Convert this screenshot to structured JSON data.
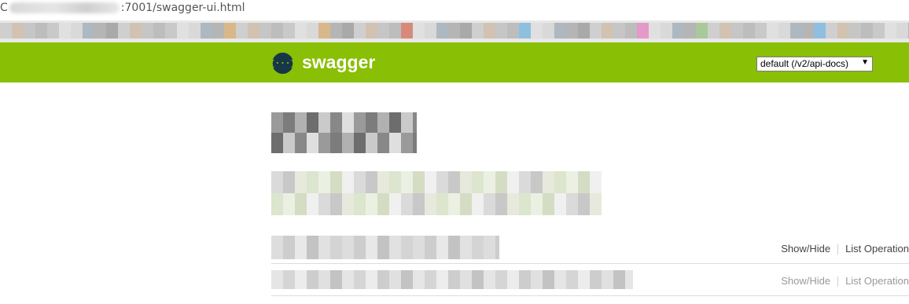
{
  "browser": {
    "url_visible_suffix": ":7001/swagger-ui.html",
    "url_prefix_char": "C"
  },
  "header": {
    "logo_glyph": "{···}",
    "title": "swagger",
    "spec_select": {
      "selected": "default (/v2/api-docs)",
      "caret": "▼"
    }
  },
  "resources": [
    {
      "show_hide_label": "Show/Hide",
      "list_operations_label": "List Operation"
    },
    {
      "show_hide_label": "Show/Hide",
      "list_operations_label": "List Operation"
    }
  ],
  "colors": {
    "header_bg": "#89bf04",
    "logo_circle": "#173647",
    "row_divider": "#dddddd"
  }
}
